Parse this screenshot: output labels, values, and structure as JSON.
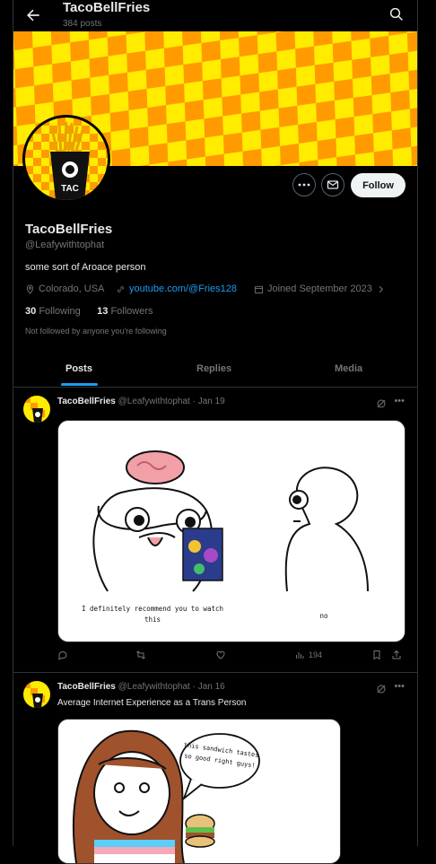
{
  "header": {
    "title": "TacoBellFries",
    "posts_count": "384 posts"
  },
  "profile": {
    "name": "TacoBellFries",
    "handle": "@Leafywithtophat",
    "bio": "some sort of Aroace person",
    "location": "Colorado, USA",
    "website": "youtube.com/@Fries128",
    "joined": "Joined September 2023",
    "following_count": "30",
    "following_label": "Following",
    "followers_count": "13",
    "followers_label": "Followers",
    "not_followed": "Not followed by anyone you're following",
    "follow_label": "Follow"
  },
  "tabs": [
    {
      "label": "Posts"
    },
    {
      "label": "Replies"
    },
    {
      "label": "Media"
    }
  ],
  "posts": [
    {
      "name": "TacoBellFries",
      "meta": "@Leafywithtophat · Jan 19",
      "text": "",
      "views": "194",
      "image_caption_left": "I definitely recommend you to watch this",
      "image_caption_right": "no"
    },
    {
      "name": "TacoBellFries",
      "meta": "@Leafywithtophat · Jan 16",
      "text": "Average Internet Experience as a Trans Person",
      "image_bubble": "this sandwich tastes so good right guys!"
    }
  ],
  "colors": {
    "accent": "#1d9bf0",
    "banner_yellow": "#ffec00",
    "banner_orange": "#ff9a00"
  }
}
